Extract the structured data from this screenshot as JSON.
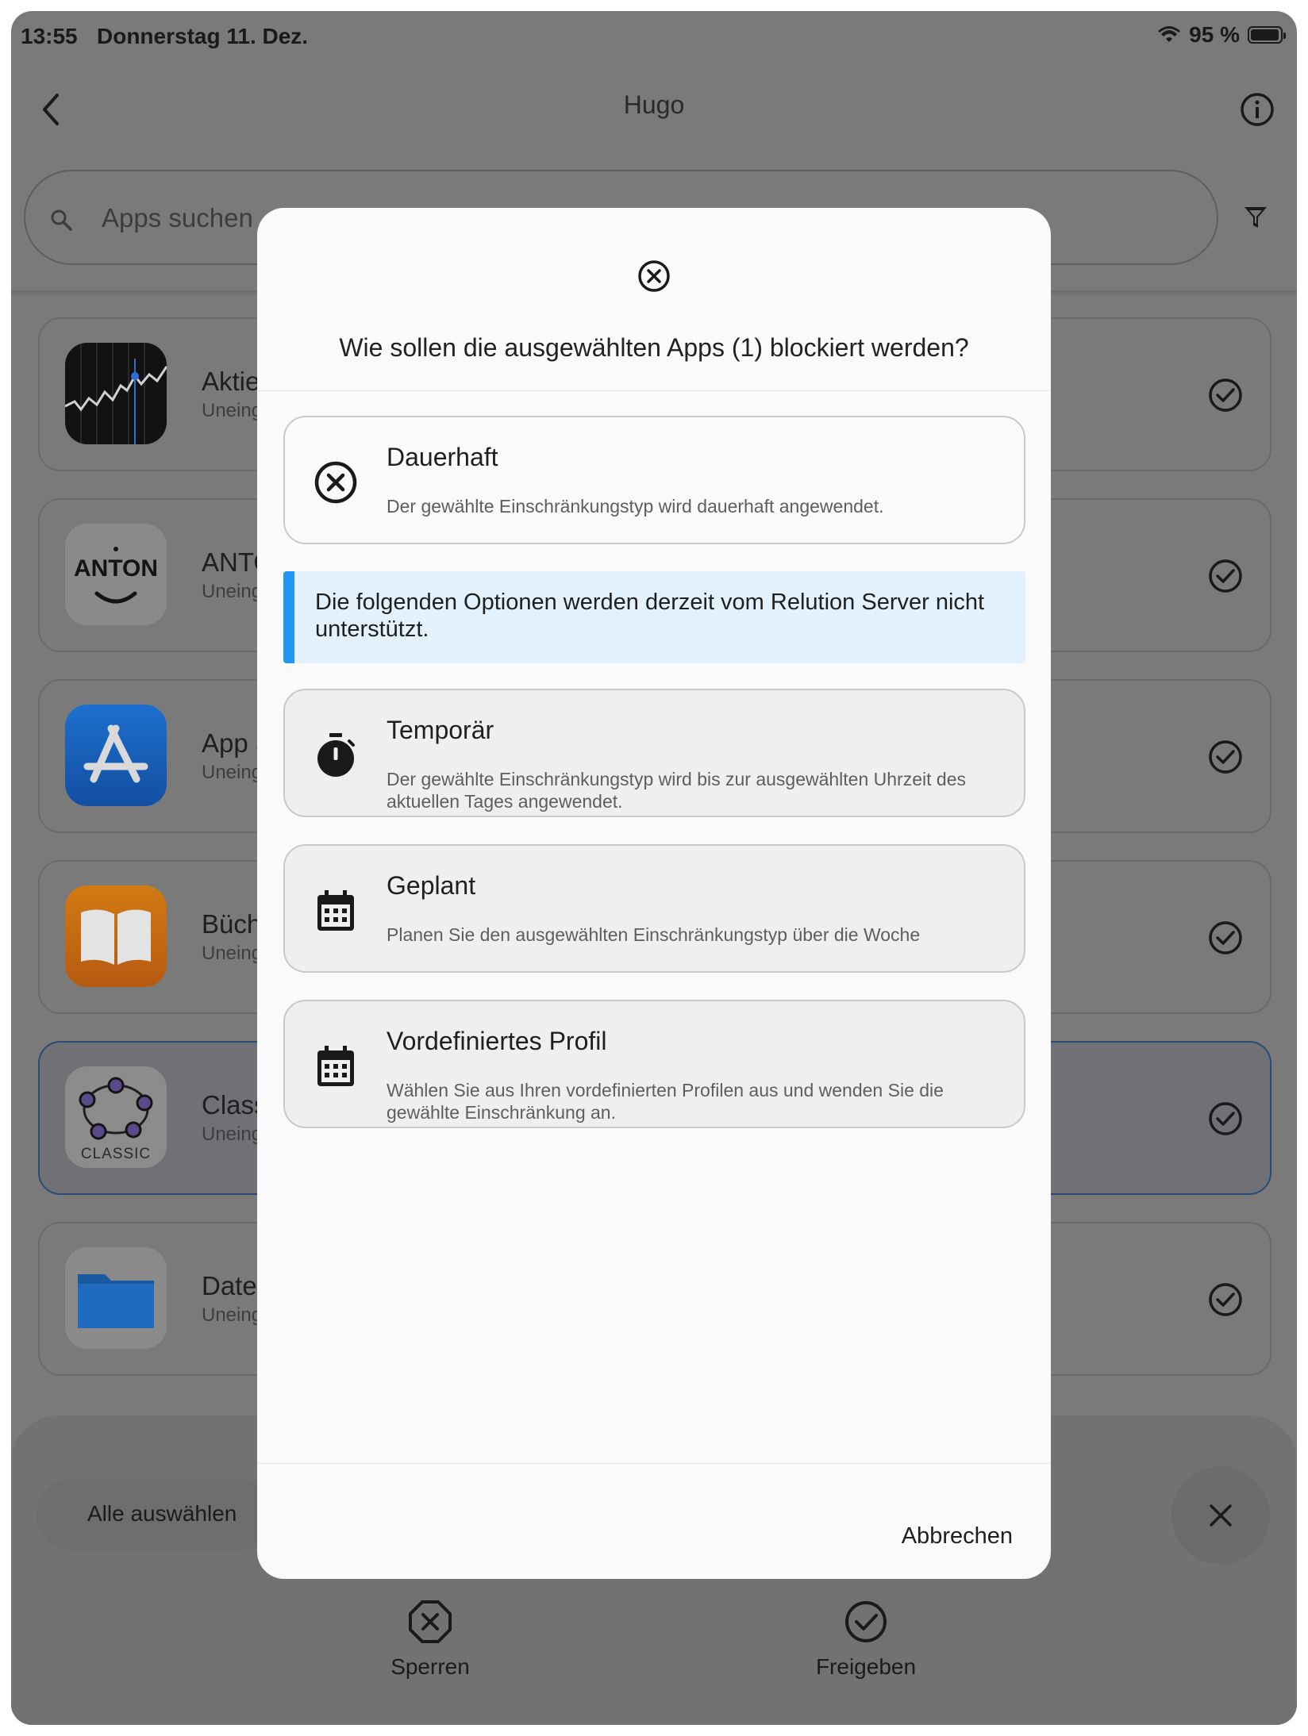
{
  "status": {
    "time": "13:55",
    "date": "Donnerstag 11. Dez.",
    "battery": "95 %"
  },
  "header": {
    "title": "Hugo"
  },
  "search": {
    "placeholder": "Apps suchen"
  },
  "apps": [
    {
      "name": "Aktien",
      "sub": "Uneing"
    },
    {
      "name": "ANTO",
      "sub": "Uneing"
    },
    {
      "name": "App S",
      "sub": "Uneing"
    },
    {
      "name": "Büche",
      "sub": "Uneing"
    },
    {
      "name": "Class",
      "sub": "Uneing"
    },
    {
      "name": "Datei",
      "sub": "Uneing"
    }
  ],
  "app_icon_text": {
    "anton": "ANTON",
    "classic": "CLASSIC"
  },
  "bottom": {
    "select_all": "Alle auswählen",
    "lock": "Sperren",
    "release": "Freigeben"
  },
  "dialog": {
    "title": "Wie sollen die ausgewählten Apps (1) blockiert werden?",
    "info": "Die folgenden Optionen werden derzeit vom Relution Server nicht unterstützt.",
    "cancel": "Abbrechen",
    "options": [
      {
        "title": "Dauerhaft",
        "desc": "Der gewählte Einschränkungstyp wird dauerhaft angewendet.",
        "icon": "cancel-icon",
        "enabled": true
      },
      {
        "title": "Temporär",
        "desc": "Der gewählte Einschränkungstyp wird bis zur ausgewählten Uhrzeit des aktuellen Tages angewendet.",
        "icon": "timer-icon",
        "enabled": false
      },
      {
        "title": "Geplant",
        "desc": "Planen Sie den ausgewählten Einschränkungstyp über die Woche",
        "icon": "calendar-icon",
        "enabled": false
      },
      {
        "title": "Vordefiniertes Profil",
        "desc": "Wählen Sie aus Ihren vordefinierten Profilen aus und wenden Sie die gewählte Einschränkung an.",
        "icon": "calendar-icon",
        "enabled": false
      }
    ]
  },
  "colors": {
    "info_accent": "#2196f3",
    "info_bg": "#e3f1fc",
    "scrim": "#7a7a7a"
  }
}
